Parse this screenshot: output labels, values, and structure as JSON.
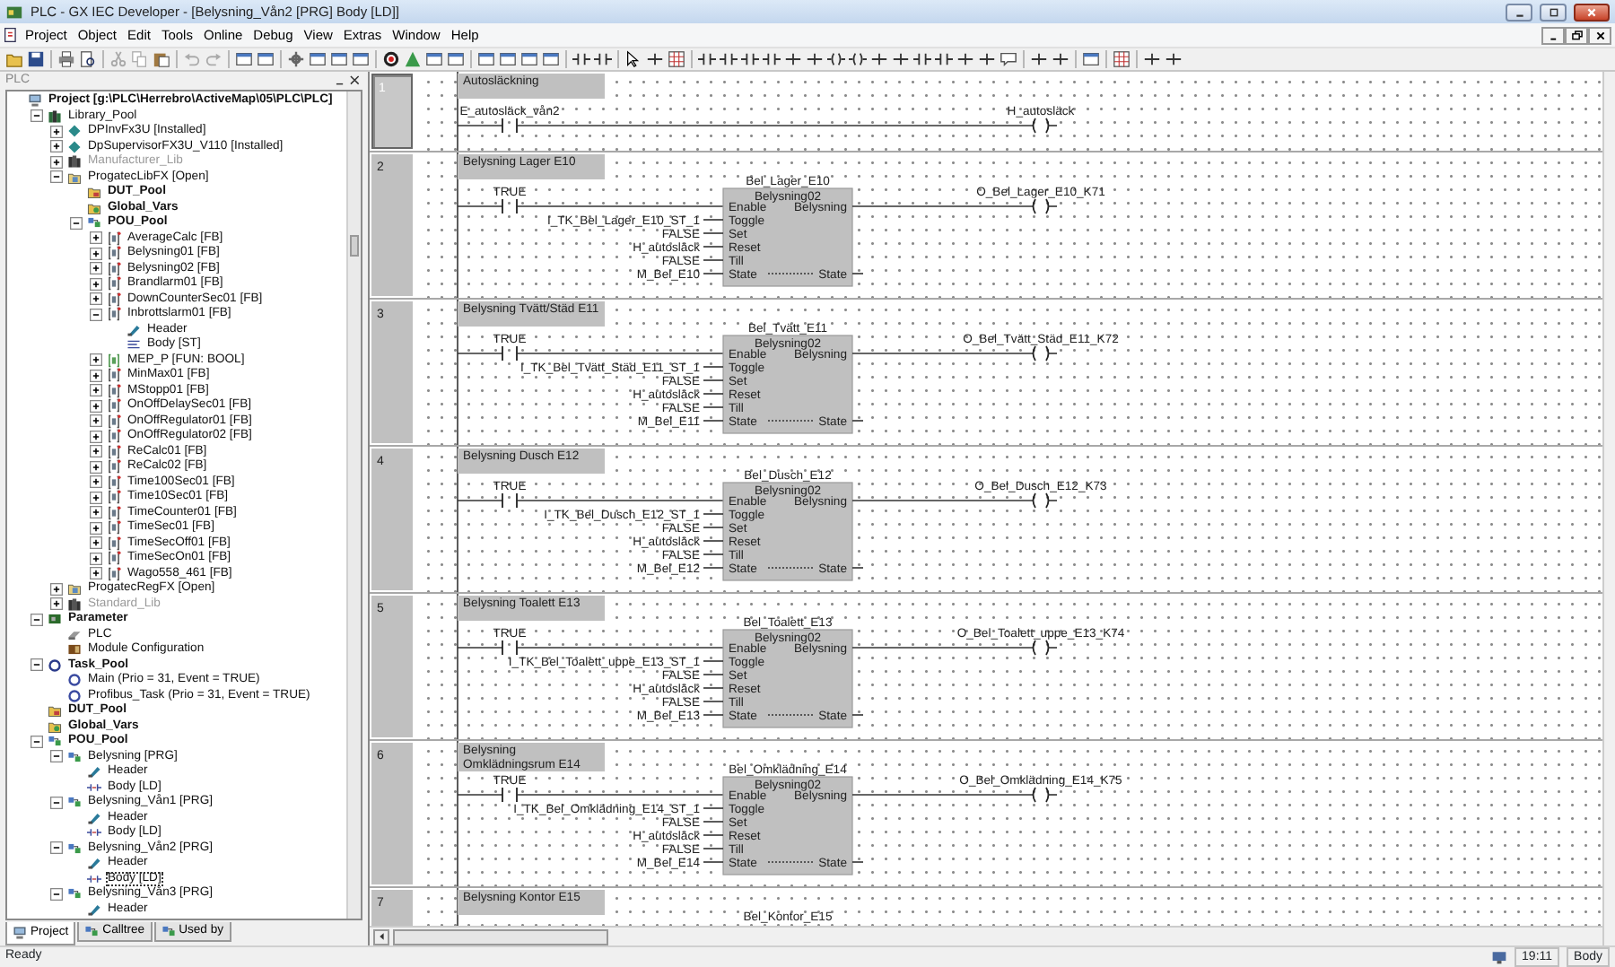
{
  "window": {
    "title": "PLC - GX IEC Developer - [Belysning_Vån2 [PRG] Body [LD]]"
  },
  "menu": [
    "Project",
    "Object",
    "Edit",
    "Tools",
    "Online",
    "Debug",
    "View",
    "Extras",
    "Window",
    "Help"
  ],
  "panel_title": "PLC",
  "project_tree": {
    "label": "Project [g:\\PLC\\Herrebro\\ActiveMap\\05\\PLC\\PLC]",
    "kind": "project",
    "selected": false,
    "children": [
      {
        "label": "Library_Pool",
        "kind": "library-pool",
        "expanded": true,
        "selected": false,
        "children": [
          {
            "label": "DPInvFx3U [Installed]",
            "kind": "installed-lib",
            "expanded": false,
            "selected": false
          },
          {
            "label": "DpSupervisorFX3U_V110 [Installed]",
            "kind": "installed-lib",
            "expanded": false,
            "selected": false
          },
          {
            "label": "Manufacturer_Lib",
            "kind": "lib-missing",
            "expanded": false,
            "selected": false
          },
          {
            "label": "ProgatecLibFX [Open]",
            "kind": "user-lib",
            "expanded": true,
            "selected": false,
            "children": [
              {
                "label": "DUT_Pool",
                "kind": "dut-pool",
                "selected": false
              },
              {
                "label": "Global_Vars",
                "kind": "globals",
                "selected": false
              },
              {
                "label": "POU_Pool",
                "kind": "pou-pool",
                "expanded": true,
                "selected": false,
                "children": [
                  {
                    "label": "AverageCalc [FB]",
                    "kind": "fb",
                    "expanded": false,
                    "selected": false
                  },
                  {
                    "label": "Belysning01 [FB]",
                    "kind": "fb",
                    "expanded": false,
                    "selected": false
                  },
                  {
                    "label": "Belysning02 [FB]",
                    "kind": "fb",
                    "expanded": false,
                    "selected": false
                  },
                  {
                    "label": "Brandlarm01 [FB]",
                    "kind": "fb",
                    "expanded": false,
                    "selected": false
                  },
                  {
                    "label": "DownCounterSec01 [FB]",
                    "kind": "fb",
                    "expanded": false,
                    "selected": false
                  },
                  {
                    "label": "Inbrottslarm01 [FB]",
                    "kind": "fb",
                    "expanded": true,
                    "selected": false,
                    "children": [
                      {
                        "label": "Header",
                        "kind": "header",
                        "selected": false
                      },
                      {
                        "label": "Body [ST]",
                        "kind": "body-st",
                        "selected": false
                      }
                    ]
                  },
                  {
                    "label": "MEP_P [FUN: BOOL]",
                    "kind": "fun",
                    "expanded": false,
                    "selected": false
                  },
                  {
                    "label": "MinMax01 [FB]",
                    "kind": "fb",
                    "expanded": false,
                    "selected": false
                  },
                  {
                    "label": "MStopp01 [FB]",
                    "kind": "fb",
                    "expanded": false,
                    "selected": false
                  },
                  {
                    "label": "OnOffDelaySec01 [FB]",
                    "kind": "fb",
                    "expanded": false,
                    "selected": false
                  },
                  {
                    "label": "OnOffRegulator01 [FB]",
                    "kind": "fb",
                    "expanded": false,
                    "selected": false
                  },
                  {
                    "label": "OnOffRegulator02 [FB]",
                    "kind": "fb",
                    "expanded": false,
                    "selected": false
                  },
                  {
                    "label": "ReCalc01 [FB]",
                    "kind": "fb",
                    "expanded": false,
                    "selected": false
                  },
                  {
                    "label": "ReCalc02 [FB]",
                    "kind": "fb",
                    "expanded": false,
                    "selected": false
                  },
                  {
                    "label": "Time100Sec01 [FB]",
                    "kind": "fb",
                    "expanded": false,
                    "selected": false
                  },
                  {
                    "label": "Time10Sec01 [FB]",
                    "kind": "fb",
                    "expanded": false,
                    "selected": false
                  },
                  {
                    "label": "TimeCounter01 [FB]",
                    "kind": "fb",
                    "expanded": false,
                    "selected": false
                  },
                  {
                    "label": "TimeSec01 [FB]",
                    "kind": "fb",
                    "expanded": false,
                    "selected": false
                  },
                  {
                    "label": "TimeSecOff01 [FB]",
                    "kind": "fb",
                    "expanded": false,
                    "selected": false
                  },
                  {
                    "label": "TimeSecOn01 [FB]",
                    "kind": "fb",
                    "expanded": false,
                    "selected": false
                  },
                  {
                    "label": "Wago558_461 [FB]",
                    "kind": "fb",
                    "expanded": false,
                    "selected": false
                  }
                ]
              }
            ]
          },
          {
            "label": "ProgatecRegFX [Open]",
            "kind": "user-lib",
            "expanded": false,
            "selected": false
          },
          {
            "label": "Standard_Lib",
            "kind": "lib-missing",
            "expanded": false,
            "selected": false
          }
        ]
      },
      {
        "label": "Parameter",
        "kind": "parameter",
        "expanded": true,
        "selected": false,
        "children": [
          {
            "label": "PLC",
            "kind": "plc",
            "selected": false
          },
          {
            "label": "Module Configuration",
            "kind": "module",
            "selected": false
          }
        ]
      },
      {
        "label": "Task_Pool",
        "kind": "task-pool",
        "expanded": true,
        "selected": false,
        "children": [
          {
            "label": "Main (Prio = 31, Event = TRUE)",
            "kind": "task",
            "selected": false
          },
          {
            "label": "Profibus_Task (Prio = 31, Event = TRUE)",
            "kind": "task",
            "selected": false
          }
        ]
      },
      {
        "label": "DUT_Pool",
        "kind": "dut-pool",
        "selected": false
      },
      {
        "label": "Global_Vars",
        "kind": "globals",
        "selected": false
      },
      {
        "label": "POU_Pool",
        "kind": "pou-pool",
        "expanded": true,
        "selected": false,
        "children": [
          {
            "label": "Belysning [PRG]",
            "kind": "prg",
            "expanded": true,
            "selected": false,
            "children": [
              {
                "label": "Header",
                "kind": "header",
                "selected": false
              },
              {
                "label": "Body [LD]",
                "kind": "body-ld",
                "selected": false
              }
            ]
          },
          {
            "label": "Belysning_Vån1 [PRG]",
            "kind": "prg",
            "expanded": true,
            "selected": false,
            "children": [
              {
                "label": "Header",
                "kind": "header",
                "selected": false
              },
              {
                "label": "Body [LD]",
                "kind": "body-ld",
                "selected": false
              }
            ]
          },
          {
            "label": "Belysning_Vån2 [PRG]",
            "kind": "prg",
            "expanded": true,
            "selected": false,
            "children": [
              {
                "label": "Header",
                "kind": "header",
                "selected": false
              },
              {
                "label": "Body [LD]",
                "kind": "body-ld",
                "selected": true
              }
            ]
          },
          {
            "label": "Belysning_Vån3 [PRG]",
            "kind": "prg",
            "expanded": true,
            "selected": false,
            "children": [
              {
                "label": "Header",
                "kind": "header",
                "selected": false
              }
            ]
          }
        ]
      }
    ]
  },
  "tree_tabs": [
    {
      "label": "Project",
      "selected": true
    },
    {
      "label": "Calltree",
      "selected": false
    },
    {
      "label": "Used by",
      "selected": false
    }
  ],
  "networks": [
    {
      "number": "1",
      "selected": true,
      "title": "Autosläckning",
      "contact": "E_autosläck_vån2",
      "coil": "H_autosläck"
    },
    {
      "number": "2",
      "selected": false,
      "title": "Belysning Lager E10",
      "contact": "TRUE",
      "block": {
        "instance": "Bel_Lager_E10",
        "type": "Belysning02",
        "inputs": [
          {
            "pin": "Enable"
          },
          {
            "pin": "Toggle",
            "signal": "I_TK_Bel_Lager_E10_ST_1"
          },
          {
            "pin": "Set",
            "signal": "FALSE"
          },
          {
            "pin": "Reset",
            "signal": "H_autosläck"
          },
          {
            "pin": "Till",
            "signal": "FALSE"
          },
          {
            "pin": "State",
            "signal": "M_Bel_E10"
          }
        ],
        "outputs": [
          {
            "pin": "Belysning"
          },
          {
            "pin": "State"
          }
        ]
      },
      "coil": "O_Bel_Lager_E10_K71"
    },
    {
      "number": "3",
      "selected": false,
      "title": "Belysning Tvätt/Städ E11",
      "contact": "TRUE",
      "block": {
        "instance": "Bel_Tvätt_E11",
        "type": "Belysning02",
        "inputs": [
          {
            "pin": "Enable"
          },
          {
            "pin": "Toggle",
            "signal": "I_TK_Bel_Tvätt_Städ_E11_ST_1"
          },
          {
            "pin": "Set",
            "signal": "FALSE"
          },
          {
            "pin": "Reset",
            "signal": "H_autosläck"
          },
          {
            "pin": "Till",
            "signal": "FALSE"
          },
          {
            "pin": "State",
            "signal": "M_Bel_E11"
          }
        ],
        "outputs": [
          {
            "pin": "Belysning"
          },
          {
            "pin": "State"
          }
        ]
      },
      "coil": "O_Bel_Tvätt_Städ_E11_K72"
    },
    {
      "number": "4",
      "selected": false,
      "title": "Belysning Dusch E12",
      "contact": "TRUE",
      "block": {
        "instance": "Bel_Dusch_E12",
        "type": "Belysning02",
        "inputs": [
          {
            "pin": "Enable"
          },
          {
            "pin": "Toggle",
            "signal": "I_TK_Bel_Dusch_E12_ST_1"
          },
          {
            "pin": "Set",
            "signal": "FALSE"
          },
          {
            "pin": "Reset",
            "signal": "H_autosläck"
          },
          {
            "pin": "Till",
            "signal": "FALSE"
          },
          {
            "pin": "State",
            "signal": "M_Bel_E12"
          }
        ],
        "outputs": [
          {
            "pin": "Belysning"
          },
          {
            "pin": "State"
          }
        ]
      },
      "coil": "O_Bel_Dusch_E12_K73"
    },
    {
      "number": "5",
      "selected": false,
      "title": "Belysning Toalett E13",
      "contact": "TRUE",
      "block": {
        "instance": "Bel_Toalett_E13",
        "type": "Belysning02",
        "inputs": [
          {
            "pin": "Enable"
          },
          {
            "pin": "Toggle",
            "signal": "I_TK_Bel_Toalett_uppe_E13_ST_1"
          },
          {
            "pin": "Set",
            "signal": "FALSE"
          },
          {
            "pin": "Reset",
            "signal": "H_autosläck"
          },
          {
            "pin": "Till",
            "signal": "FALSE"
          },
          {
            "pin": "State",
            "signal": "M_Bel_E13"
          }
        ],
        "outputs": [
          {
            "pin": "Belysning"
          },
          {
            "pin": "State"
          }
        ]
      },
      "coil": "O_Bel_Toalett_uppe_E13_K74"
    },
    {
      "number": "6",
      "selected": false,
      "title": "Belysning Omklädningsrum E14",
      "contact": "TRUE",
      "block": {
        "instance": "Bel_Omklädning_E14",
        "type": "Belysning02",
        "inputs": [
          {
            "pin": "Enable"
          },
          {
            "pin": "Toggle",
            "signal": "I_TK_Bel_Omklädning_E14_ST_1"
          },
          {
            "pin": "Set",
            "signal": "FALSE"
          },
          {
            "pin": "Reset",
            "signal": "H_autosläck"
          },
          {
            "pin": "Till",
            "signal": "FALSE"
          },
          {
            "pin": "State",
            "signal": "M_Bel_E14"
          }
        ],
        "outputs": [
          {
            "pin": "Belysning"
          },
          {
            "pin": "State"
          }
        ]
      },
      "coil": "O_Bel_Omklädning_E14_K75"
    },
    {
      "number": "7",
      "selected": false,
      "title": "Belysning Kontor E15",
      "block": {
        "instance": "Bel_Kontor_E15"
      }
    }
  ],
  "status_bar": {
    "message": "Ready",
    "time": "19:11",
    "context": "Body"
  }
}
